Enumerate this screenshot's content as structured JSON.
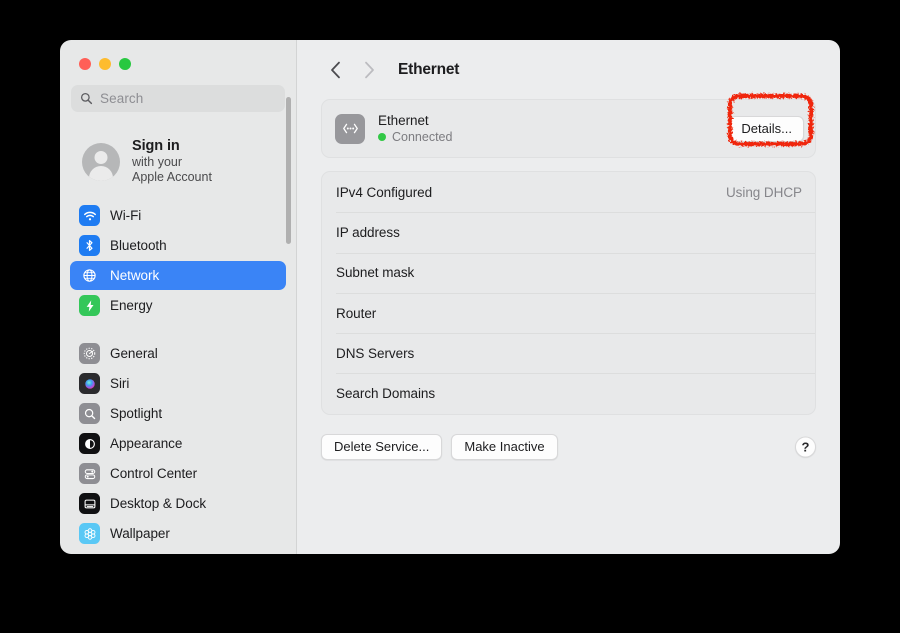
{
  "window": {
    "traffic_lights": [
      {
        "name": "close",
        "color": "#ff5f57"
      },
      {
        "name": "minimize",
        "color": "#febc2e"
      },
      {
        "name": "maximize",
        "color": "#28c840"
      }
    ]
  },
  "sidebar": {
    "search": {
      "placeholder": "Search",
      "value": "",
      "icon": "search-icon"
    },
    "account": {
      "title": "Sign in",
      "line2": "with your",
      "line3": "Apple Account",
      "avatar_icon": "person-icon"
    },
    "groups": [
      {
        "items": [
          {
            "id": "wifi",
            "label": "Wi-Fi",
            "icon": "wifi-icon",
            "icon_bg": "#1f7cf2",
            "selected": false
          },
          {
            "id": "bluetooth",
            "label": "Bluetooth",
            "icon": "bluetooth-icon",
            "icon_bg": "#1f7cf2",
            "selected": false
          },
          {
            "id": "network",
            "label": "Network",
            "icon": "globe-icon",
            "icon_bg": "#3a84f6",
            "selected": true
          },
          {
            "id": "energy",
            "label": "Energy",
            "icon": "bolt-icon",
            "icon_bg": "#34c759",
            "selected": false
          }
        ]
      },
      {
        "items": [
          {
            "id": "general",
            "label": "General",
            "icon": "gear-icon",
            "icon_bg": "#8e8e93",
            "selected": false
          },
          {
            "id": "siri",
            "label": "Siri",
            "icon": "siri-orb-icon",
            "icon_bg": "#2b2b2e",
            "selected": false
          },
          {
            "id": "spotlight",
            "label": "Spotlight",
            "icon": "magnifier-icon",
            "icon_bg": "#8e8e93",
            "selected": false
          },
          {
            "id": "appearance",
            "label": "Appearance",
            "icon": "contrast-icon",
            "icon_bg": "#101012",
            "selected": false
          },
          {
            "id": "control-center",
            "label": "Control Center",
            "icon": "sliders-icon",
            "icon_bg": "#8e8e93",
            "selected": false
          },
          {
            "id": "desktop-dock",
            "label": "Desktop & Dock",
            "icon": "desktop-icon",
            "icon_bg": "#101012",
            "selected": false
          },
          {
            "id": "wallpaper",
            "label": "Wallpaper",
            "icon": "flower-icon",
            "icon_bg": "#5ac8f5",
            "selected": false
          }
        ]
      }
    ]
  },
  "content": {
    "nav": {
      "back_icon": "chevron-left-icon",
      "forward_icon": "chevron-right-icon",
      "back_enabled": true,
      "forward_enabled": false,
      "title": "Ethernet"
    },
    "service": {
      "icon": "ethernet-icon",
      "name": "Ethernet",
      "status": "Connected",
      "status_color": "#32c846",
      "details_label": "Details..."
    },
    "info_rows": [
      {
        "label": "IPv4 Configured",
        "value": "Using DHCP"
      },
      {
        "label": "IP address",
        "value": ""
      },
      {
        "label": "Subnet mask",
        "value": ""
      },
      {
        "label": "Router",
        "value": ""
      },
      {
        "label": "DNS Servers",
        "value": ""
      },
      {
        "label": "Search Domains",
        "value": ""
      }
    ],
    "buttons": {
      "delete_service": "Delete Service...",
      "make_inactive": "Make Inactive",
      "help": "?"
    }
  },
  "annotation": {
    "target": "details-button",
    "color": "#f02810",
    "shape": "rounded-rectangle"
  }
}
